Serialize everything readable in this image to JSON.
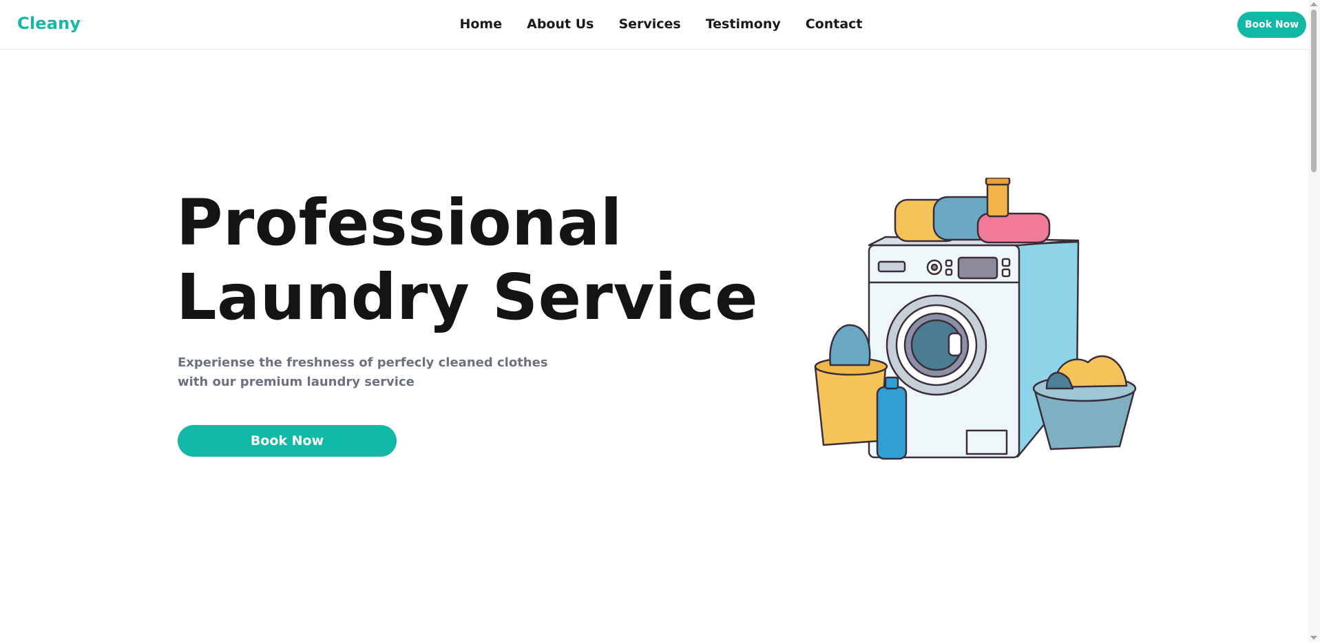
{
  "brand": {
    "name": "Cleany"
  },
  "nav": {
    "items": [
      {
        "label": "Home"
      },
      {
        "label": "About Us"
      },
      {
        "label": "Services"
      },
      {
        "label": "Testimony"
      },
      {
        "label": "Contact"
      }
    ],
    "cta_label": "Book Now"
  },
  "hero": {
    "title_line1": "Professional",
    "title_line2": "Laundry Service",
    "subtitle": "Experiense the freshness of perfecly cleaned clothes with our premium laundry service",
    "cta_label": "Book Now"
  },
  "illustration": {
    "icon": "washing-machine-illustration-icon"
  },
  "colors": {
    "accent": "#12b8a6",
    "title": "#141414",
    "subtitle": "#6b7180"
  }
}
